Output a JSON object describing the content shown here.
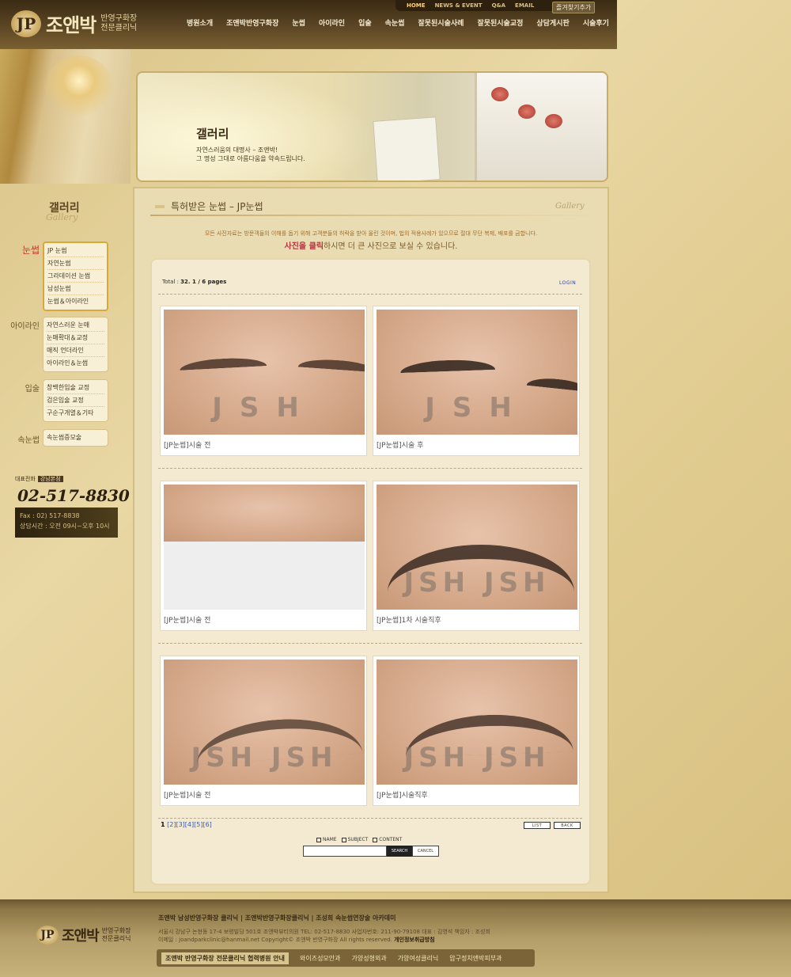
{
  "header": {
    "logo_mark": "JP",
    "brand": "조앤박",
    "brand_sub1": "반영구화장",
    "brand_sub2": "전문클리닉",
    "util": [
      "HOME",
      "NEWS & EVENT",
      "Q&A",
      "EMAIL"
    ],
    "favorite": "즐겨찾기추가",
    "nav": [
      "병원소개",
      "조앤박반영구화장",
      "눈썹",
      "아이라인",
      "입술",
      "속눈썹",
      "잘못된시술사례",
      "잘못된시술교정",
      "상담게시판",
      "시술후기"
    ]
  },
  "visual": {
    "title": "갤러리",
    "desc1": "자연스러움의 대명사 – 조앤박!",
    "desc2": "그 명성 그대로 아름다움을 약속드립니다."
  },
  "sidebar": {
    "title": "갤러리",
    "subtitle": "Gallery",
    "groups": [
      {
        "label": "눈썹",
        "items": [
          "JP 눈썹",
          "자연눈썹",
          "그라데이션 눈썹",
          "남성눈썹",
          "눈썹＆아이라인"
        ]
      },
      {
        "label": "아이라인",
        "items": [
          "자연스러운 눈매",
          "눈매확대＆교정",
          "매직 언더라인",
          "아이라인＆눈썹"
        ]
      },
      {
        "label": "입술",
        "items": [
          "창백한입술 교정",
          "검은입술 교정",
          "구순구개열＆기타"
        ]
      },
      {
        "label": "속눈썹",
        "items": [
          "속눈썹증모술"
        ]
      }
    ],
    "contact_label": "대표전화",
    "branch": "강남본점",
    "phone": "02-517-8830",
    "fax": "Fax : 02) 517-8838",
    "hours": "상담시간 : 오전 09시~오후 10시"
  },
  "content": {
    "title": "특허받은 눈썹 – JP눈썹",
    "title_eng": "Gallery",
    "notice": "모든 사진자료는 방문객들의 이해를 돕기 위해 고객분들의 허락을 받아 올린 것이며, 법의 적용사례가 있으므로 절대 무단 복제, 배포를 금합니다.",
    "notice_hl": "사진을 클릭",
    "notice_rest": "하시면 더 큰 사진으로 보실 수 있습니다.",
    "total_label": "Total :",
    "total_value": "32. 1 / 6 pages",
    "login": "LOGIN",
    "gallery": [
      {
        "caption": "[JP눈썹]시술 전",
        "watermark": "JSH"
      },
      {
        "caption": "[JP눈썹]시술 후",
        "watermark": "JSH"
      },
      {
        "caption": "[JP눈썹]시술 전",
        "watermark": ""
      },
      {
        "caption": "[JP눈썹]1차 시술직후",
        "watermark": "JSH JSH"
      },
      {
        "caption": "[JP눈썹]시술 전",
        "watermark": "JSH JSH"
      },
      {
        "caption": "[JP눈썹]시술직후",
        "watermark": "JSH JSH"
      }
    ],
    "pager_current": "1",
    "pager_pages": "[2][3][4][5][6]",
    "btn_list": "LIST",
    "btn_back": "BACK",
    "search_opts": [
      "NAME",
      "SUBJECT",
      "CONTENT"
    ],
    "search_btn": "SEARCH",
    "cancel_btn": "CANCEL"
  },
  "footer": {
    "links": "조앤박 남성반영구화장 클리닉 | 조앤박반영구화장클리닉 | 조성희 속눈썹연장술 아카데미",
    "address": "서울시 강남구 논현동 17-4 보령빌딩 501호 조앤박뷰티의원 TEL: 02-517-8830 사업자번호: 211-90-79108 대표 : 김영석 책임자 : 조성희",
    "email": "이메일 : joandparkclinic@hanmail.net Copyright© 조앤박 반영구화장 All rights reserved.",
    "privacy": "개인정보취급방침",
    "partner_head": "조앤박 반영구화장 전문클리닉 협력병원 안내",
    "partners": [
      "와이즈성모안과",
      "가양성형외과",
      "가양여성클리닉",
      "압구정치앤박피부과"
    ]
  }
}
